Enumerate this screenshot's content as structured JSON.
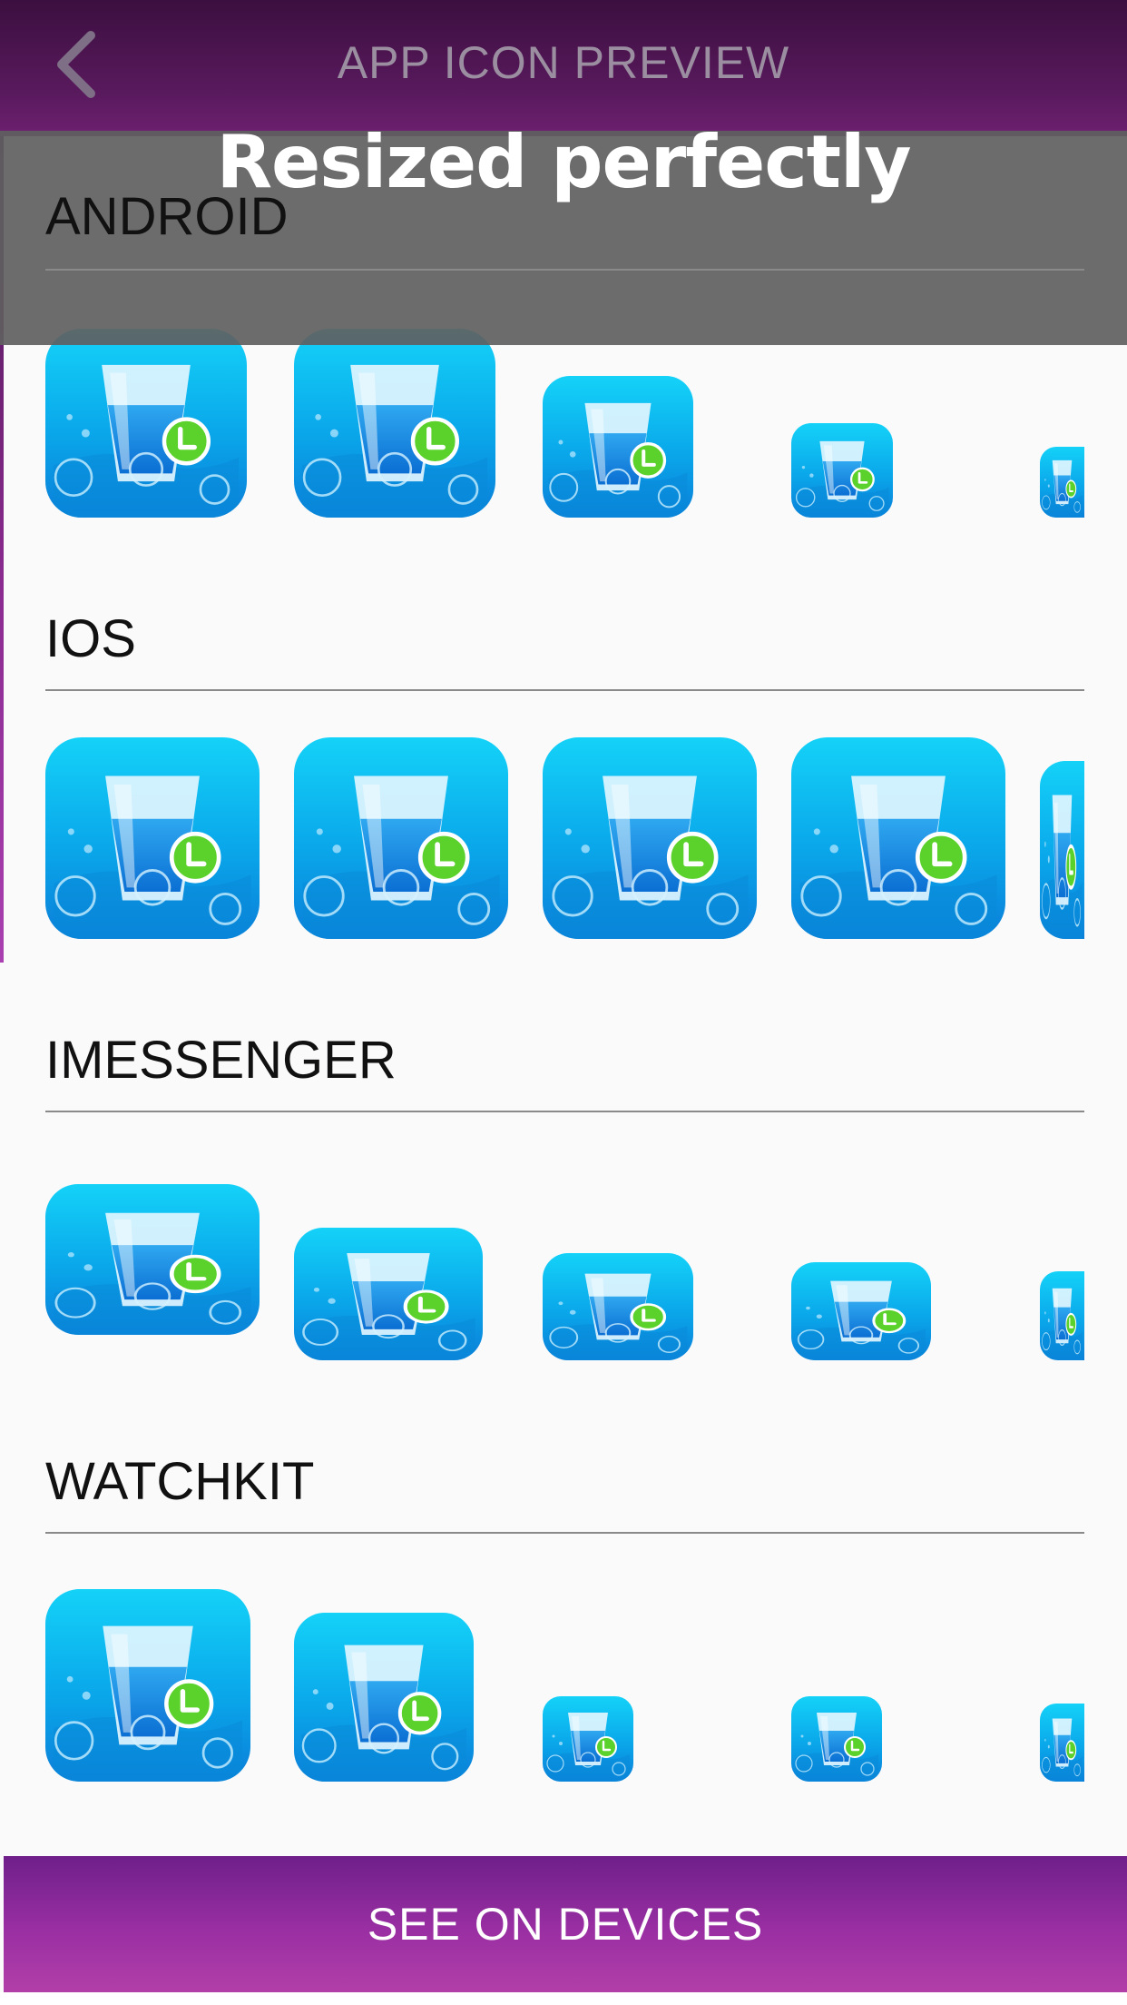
{
  "header": {
    "title": "APP ICON PREVIEW",
    "back_icon": "chevron-left-icon"
  },
  "overlay": {
    "caption": "Resized perfectly"
  },
  "sections": [
    {
      "label": "ANDROID"
    },
    {
      "label": "IOS"
    },
    {
      "label": "IMESSENGER"
    },
    {
      "label": "WATCHKIT"
    }
  ],
  "footer": {
    "button_label": "SEE ON DEVICES"
  },
  "colors": {
    "header": "#4a1450",
    "accent": "#9a2fa3",
    "icon_blue": "#0aa7ea",
    "badge_green": "#5bd22b"
  }
}
